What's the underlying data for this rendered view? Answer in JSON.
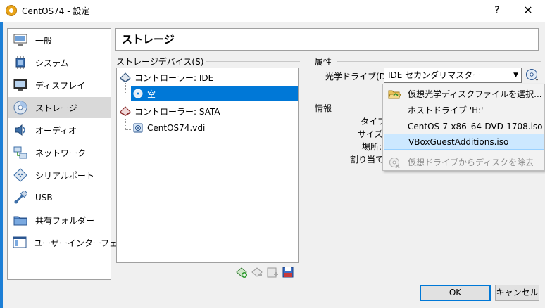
{
  "window": {
    "title": "CentOS74 - 設定",
    "help": "?",
    "close": "✕"
  },
  "categories": [
    {
      "label": "一般",
      "icon": "monitor-general-icon"
    },
    {
      "label": "システム",
      "icon": "chip-icon"
    },
    {
      "label": "ディスプレイ",
      "icon": "display-icon"
    },
    {
      "label": "ストレージ",
      "icon": "cd-drive-icon",
      "selected": true
    },
    {
      "label": "オーディオ",
      "icon": "speaker-icon"
    },
    {
      "label": "ネットワーク",
      "icon": "network-icon"
    },
    {
      "label": "シリアルポート",
      "icon": "serial-port-icon"
    },
    {
      "label": "USB",
      "icon": "usb-icon"
    },
    {
      "label": "共有フォルダー",
      "icon": "shared-folder-icon"
    },
    {
      "label": "ユーザーインターフェース",
      "icon": "user-interface-icon"
    }
  ],
  "page_title": "ストレージ",
  "storage_devices": {
    "group_label": "ストレージデバイス(S)",
    "controller_ide": "コントローラー: IDE",
    "ide_empty": "空",
    "controller_sata": "コントローラー: SATA",
    "sata_disk": "CentOS74.vdi"
  },
  "attributes": {
    "group_label": "属性",
    "optical_drive_label": "光学ドライブ(D):",
    "optical_drive_value": "IDE セカンダリマスター"
  },
  "info": {
    "group_label": "情報",
    "type_label": "タイプ:",
    "size_label": "サイズ:",
    "location_label": "場所:",
    "attached_label": "割り当て:"
  },
  "dropdown_menu": {
    "items": [
      {
        "label": "仮想光学ディスクファイルを選択...",
        "icon": "folder-open-icon"
      },
      {
        "label": "ホストドライブ 'H:'",
        "icon": ""
      },
      {
        "label": "CentOS-7-x86_64-DVD-1708.iso",
        "icon": ""
      },
      {
        "label": "VBoxGuestAdditions.iso",
        "icon": "",
        "highlighted": true
      },
      {
        "label": "仮想ドライブからディスクを除去",
        "icon": "remove-disk-icon",
        "disabled": true
      }
    ]
  },
  "buttons": {
    "ok": "OK",
    "cancel": "キャンセル"
  },
  "colors": {
    "selection": "#0078d7",
    "accent_bar": "#1d7fd6",
    "menu_highlight": "#cce8ff"
  }
}
